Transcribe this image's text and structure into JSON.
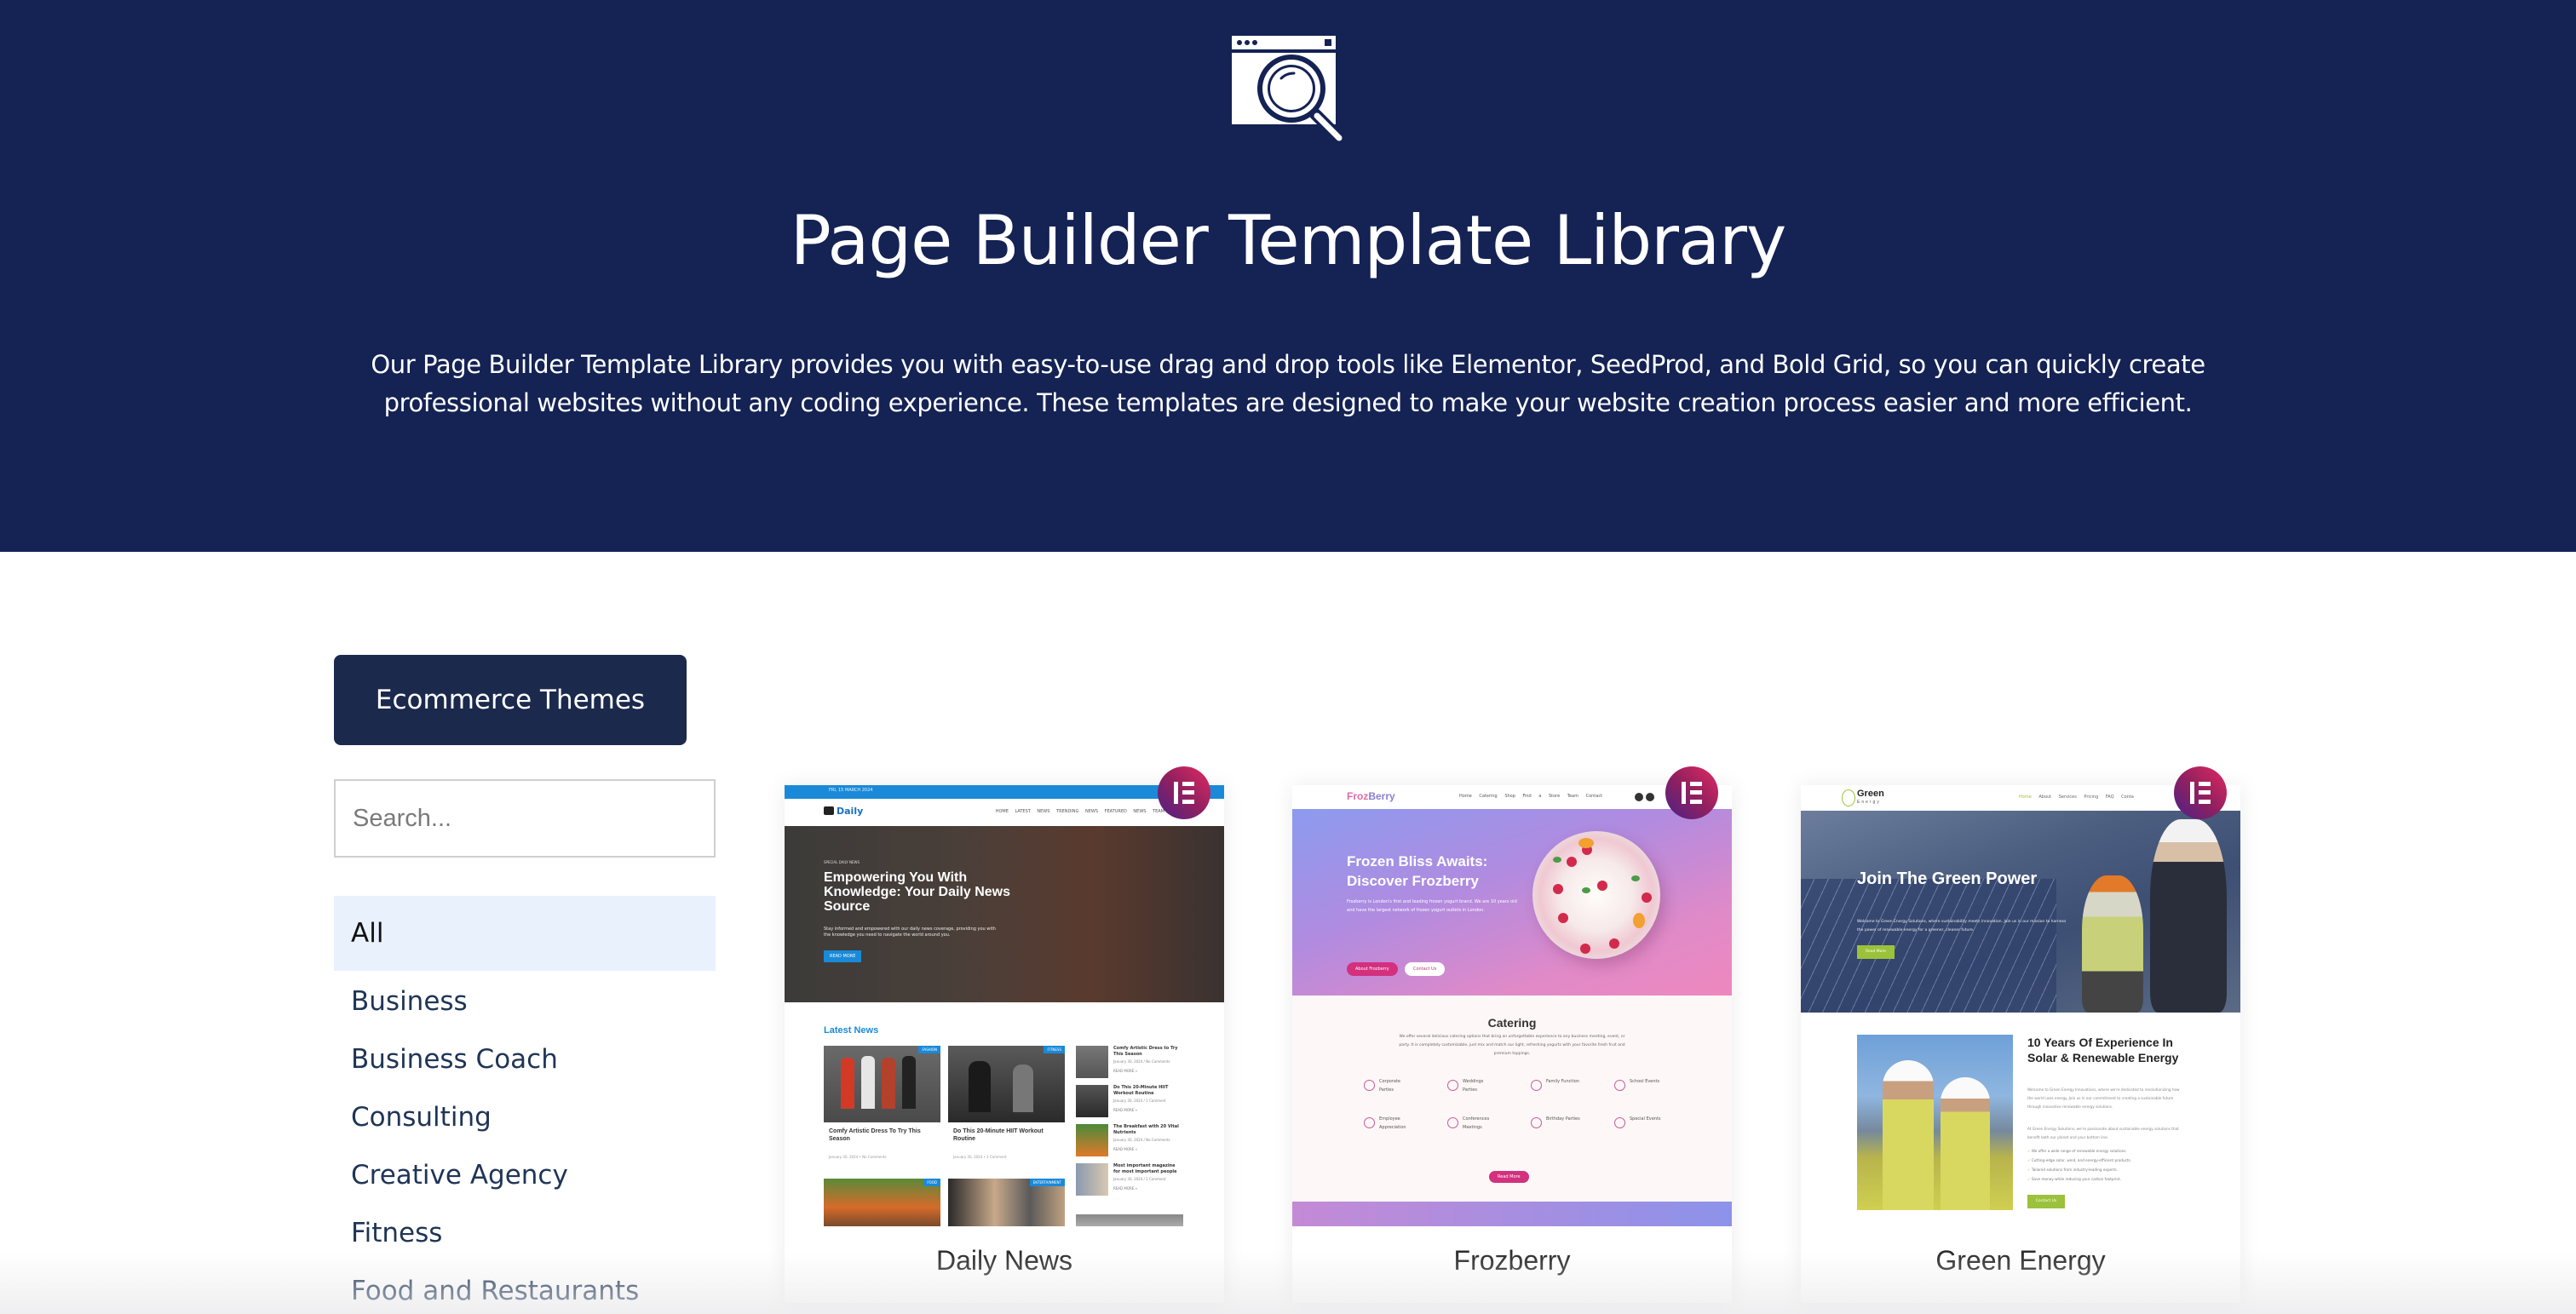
{
  "hero": {
    "icon": "browser-search-icon",
    "title": "Page Builder Template Library",
    "description": "Our Page Builder Template Library provides you with easy-to-use drag and drop tools like Elementor, SeedProd, and Bold Grid, so you can quickly create professional websites without any coding experience. These templates are designed to make your website creation process easier and more efficient.",
    "background": "#142254"
  },
  "sidebar": {
    "ecommerce_button": "Ecommerce Themes",
    "search_placeholder": "Search...",
    "search_value": "",
    "categories": [
      {
        "label": "All",
        "active": true
      },
      {
        "label": "Business",
        "active": false
      },
      {
        "label": "Business Coach",
        "active": false
      },
      {
        "label": "Consulting",
        "active": false
      },
      {
        "label": "Creative Agency",
        "active": false
      },
      {
        "label": "Fitness",
        "active": false
      },
      {
        "label": "Food and Restaurants",
        "active": false
      }
    ]
  },
  "templates": [
    {
      "name": "Daily News",
      "builder": "Elementor",
      "builder_icon": "elementor-icon",
      "preview": {
        "date_bar": "FRI, 15 MARCH 2024",
        "logo": "Daily",
        "menu": "HOME  LATEST NEWS  TRENDING NEWS  FEATURED NEWS  TEAM",
        "kicker": "SPECIAL DAILY NEWS",
        "headline": "Empowering You With Knowledge: Your Daily News Source",
        "subtext": "Stay informed and empowered with our daily news coverage, providing you with the knowledge you need to navigate the world around you.",
        "cta": "READ MORE",
        "section_title": "Latest News",
        "tiles": [
          {
            "tag": "FASHION",
            "title": "Comfy Artistic Dress To Try This Season",
            "meta": "January 30, 2024 • No Comments"
          },
          {
            "tag": "FITNESS",
            "title": "Do This 20-Minute HIIT Workout Routine",
            "meta": "January 30, 2024 • 1 Comment"
          },
          {
            "tag": "FOOD",
            "title": "",
            "meta": ""
          },
          {
            "tag": "ENTERTAINMENT",
            "title": "",
            "meta": ""
          }
        ],
        "side_items": [
          {
            "title": "Comfy Artistic Dress to Try This Season",
            "meta": "January 30, 2024 / No Comments",
            "link": "READ MORE »"
          },
          {
            "title": "Do This 20-Minute HIIT Workout Routine",
            "meta": "January 30, 2024 / 1 Comment",
            "link": "READ MORE »"
          },
          {
            "title": "The Breakfast with 20 Vital Nutrients",
            "meta": "January 30, 2024 / No Comments",
            "link": "READ MORE »"
          },
          {
            "title": "Most important magazine for most important people",
            "meta": "January 30, 2024 / 1 Comment",
            "link": "READ MORE »"
          }
        ]
      }
    },
    {
      "name": "Frozberry",
      "builder": "Elementor",
      "builder_icon": "elementor-icon",
      "preview": {
        "logo_a": "Froz",
        "logo_b": "Berry",
        "menu": "Home  Catering  Shop  Find a Store  Team  Contact",
        "headline": "Frozen Bliss Awaits: Discover Frozberry",
        "subtext": "Frozberry is London's first and leading frozen yogurt brand. We are 10 years old and have the largest network of frozen yogurt outlets in London.",
        "cta_primary": "About Frozberry",
        "cta_secondary": "Contact Us",
        "section_title": "Catering",
        "section_text": "We offer several delicious catering options that bring an unforgettable experience to any business meeting, event, or party. It is completely customizable, just mix and match our light, refreshing yogurts with your favorite fresh fruit and premium toppings.",
        "services": [
          "Corporate Parties",
          "Weddings Parties",
          "Family Function",
          "School Events",
          "Employee Appreciation",
          "Conferences Meetings",
          "Birthday Parties",
          "Special Events"
        ],
        "read_more": "Read More"
      }
    },
    {
      "name": "Green Energy",
      "builder": "Elementor",
      "builder_icon": "elementor-icon",
      "preview": {
        "logo": "Green",
        "logo_sub": "Energy",
        "menu_active": "Home",
        "menu": "About  Services  Pricing  FAQ  Conta",
        "headline": "Join The Green Power",
        "subtext": "Welcome to Green Energy Solutions, where sustainability meets innovation. Join us in our mission to harness the power of renewable energy for a greener, cleaner future.",
        "cta": "Read More",
        "section_title": "10 Years Of Experience In Solar & Renewable Energy",
        "para1": "Welcome to Green Energy Innovations, where we're dedicated to revolutionizing how the world uses energy. Join us in our commitment to creating a sustainable future through innovative renewable energy solutions.",
        "para2": "At Green Energy Solutions, we're passionate about sustainable energy solutions that benefit both our planet and your bottom line.",
        "checks": [
          "We offer a wide range of renewable energy solutions.",
          "Cutting-edge solar, wind, and energy-efficient products.",
          "Tailored solutions from industry-leading experts.",
          "Save money while reducing your carbon footprint."
        ],
        "contact": "Contact Us"
      }
    }
  ],
  "colors": {
    "header_bg": "#142254",
    "button_bg": "#1b294d",
    "active_category_bg": "#e9f1fd",
    "category_text": "#1f3556",
    "elementor_badge_start": "#e22a62",
    "elementor_badge_end": "#4a2287"
  }
}
